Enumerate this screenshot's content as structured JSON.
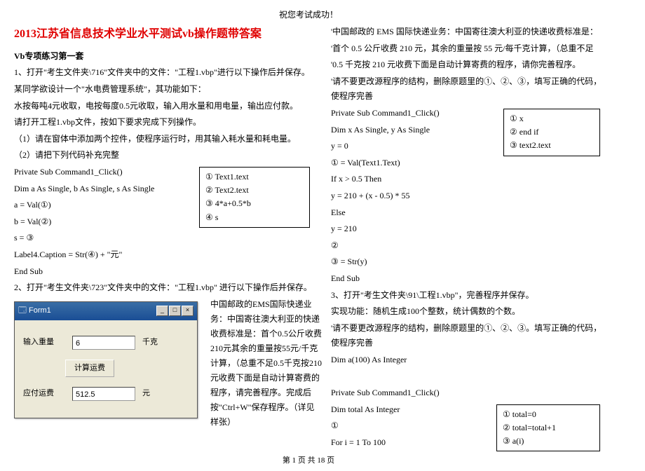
{
  "header": "祝您考试成功！",
  "title": "2013江苏省信息技术学业水平测试vb操作题带答案",
  "subtitle": "Vb专项练习第一套",
  "left": {
    "p1": "1、打开\"考生文件夹\\716\"文件夹中的文件：\"工程1.vbp\"进行以下操作后并保存。",
    "p2": "某同学欲设计一个\"水电费管理系统\"，其功能如下：",
    "p3": "水按每吨4元收取，电按每度0.5元收取，输入用水量和用电量，输出应付款。",
    "p4": "请打开工程1.vbp文件，按如下要求完成下列操作。",
    "p5": "（1）请在窗体中添加两个控件，使程序运行时，用其输入耗水量和耗电量。",
    "p6": "（2）请把下列代码补充完整",
    "code1_1": "Private Sub Command1_Click()",
    "code1_2": "Dim a As Single, b As Single, s As Single",
    "code1_3": "a = Val(①)",
    "code1_4": "b = Val(②)",
    "code1_5": "s = ③",
    "code1_6": "Label4.Caption = Str(④) + \"元\"",
    "code1_7": "End Sub",
    "p7": "2、打开\"考生文件夹\\723\"文件夹中的文件：\"工程1.vbp\"  进行以下操作后并保存。",
    "rightfloat": "中国邮政的EMS国际快递业务：中国寄往澳大利亚的快递收费标准是：首个0.5公斤收费210元其余的重量按55元/千克计算，（总重不足0.5千克按210元收费下面是自动计算寄费的程序，请完善程序。完成后按\"Ctrl+W\"保存程序。（详见样张）",
    "ans1": "①  Text1.text",
    "ans2": "②  Text2.text",
    "ans3": "③  4*a+0.5*b",
    "ans4": "④  s"
  },
  "vb": {
    "form_title": "Form1",
    "row1_label": "输入重量",
    "row1_value": "6",
    "row1_unit": "千克",
    "btn": "计算运费",
    "row2_label": "应付运费",
    "row2_value": "512.5",
    "row2_unit": "元"
  },
  "right": {
    "p1": "'中国邮政的 EMS 国际快递业务：中国寄往澳大利亚的快递收费标准是：",
    "p2": "'首个 0.5 公斤收费 210 元，其余的重量按 55 元/每千克计算，（总重不足",
    "p3": "'0.5 千克按 210 元收费下面是自动计算寄费的程序，请你完善程序。",
    "p4": "'请不要更改源程序的结构，删除原题里的①、②、③，填写正确的代码，使程序完善",
    "c1": "Private Sub Command1_Click()",
    "c2": "  Dim x As Single, y As Single",
    "c3": "  y = 0",
    "c4": "  ① = Val(Text1.Text)",
    "c5": "  If x > 0.5 Then",
    "c6": "      y = 210 + (x - 0.5) * 55",
    "c7": "  Else",
    "c8": "      y = 210",
    "c9": "  ②",
    "c10": "  ③ = Str(y)",
    "c11": "End Sub",
    "p5": "3、打开\"考生文件夹\\91\\工程1.vbp\"，完善程序并保存。",
    "p6": "实现功能：随机生成100个整数，统计偶数的个数。",
    "p7": "'请不要更改源程序的结构，删除原题里的①、②、③。填写正确的代码，使程序完善",
    "c12": "Dim a(100) As Integer",
    "c13": "Private Sub Command1_Click()",
    "c14": "    Dim total As Integer",
    "c15": "    ①",
    "c16": "    For i = 1 To 100",
    "ansA1": "①    x",
    "ansA2": "②    end if",
    "ansA3": "③    text2.text",
    "ansB1": "①   total=0",
    "ansB2": "②   total=total+1",
    "ansB3": "③   a(i)"
  },
  "footer": "第 1 页 共 18 页"
}
